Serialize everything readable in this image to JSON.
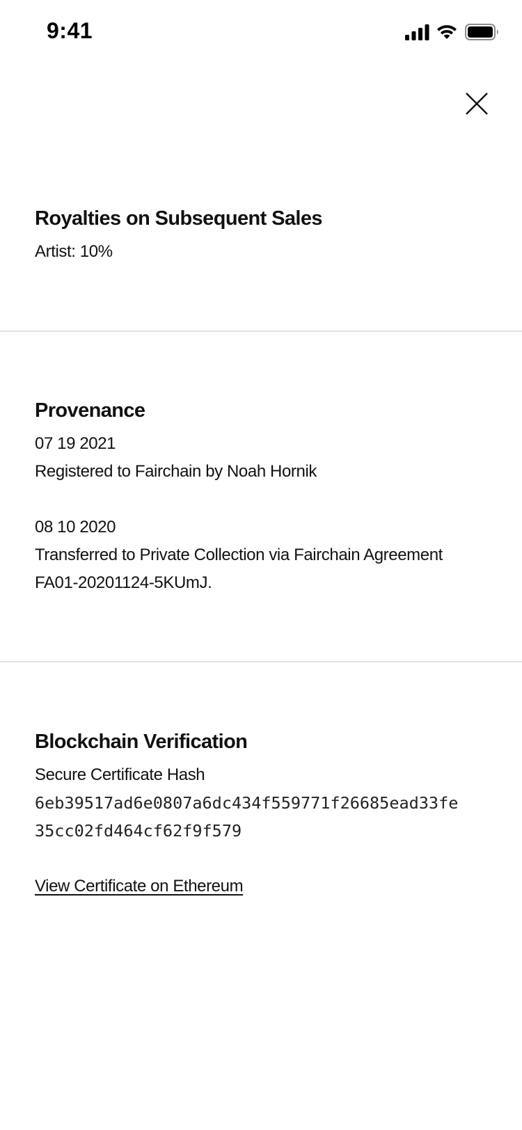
{
  "status_bar": {
    "time": "9:41",
    "icons": [
      "cellular-signal-icon",
      "wifi-icon",
      "battery-icon"
    ]
  },
  "close_icon": "close-icon",
  "royalties": {
    "title": "Royalties on Subsequent Sales",
    "artist_line": "Artist: 10%"
  },
  "provenance": {
    "title": "Provenance",
    "entries": [
      {
        "date": "07 19 2021",
        "lines": [
          "Registered to Fairchain by Noah Hornik"
        ]
      },
      {
        "date": "08 10 2020",
        "lines": [
          "Transferred to Private Collection via Fairchain Agreement",
          "FA01-20201124-5KUmJ."
        ]
      }
    ]
  },
  "blockchain": {
    "title": "Blockchain Verification",
    "hash_label": "Secure Certificate Hash",
    "hash_line_1": "6eb39517ad6e0807a6dc434f559771f26685ead33fe",
    "hash_line_2": "35cc02fd464cf62f9f579",
    "link_label": "View Certificate on Ethereum"
  }
}
